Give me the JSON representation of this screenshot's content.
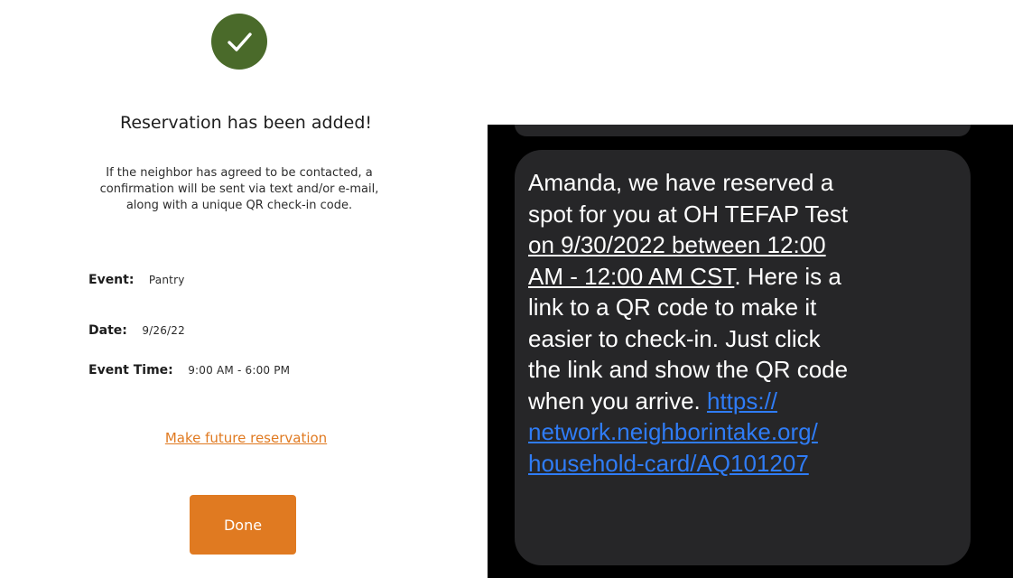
{
  "colors": {
    "success_green": "#4a6a2a",
    "accent_orange": "#e07a21",
    "link_blue": "#2f7cf6",
    "sms_background": "#000000",
    "sms_bubble": "#262628"
  },
  "confirmation": {
    "icon": "check-icon",
    "title": "Reservation has been added!",
    "description": "If the neighbor has agreed to be contacted, a\nconfirmation will be sent via text and/or e-mail,\nalong with a unique QR check-in code.",
    "details": [
      {
        "label": "Event:",
        "value": "Pantry"
      },
      {
        "label": "Date:",
        "value": "9/26/22"
      },
      {
        "label": "Event Time:",
        "value": "9:00 AM - 6:00 PM"
      }
    ],
    "future_link": "Make future reservation",
    "done_label": "Done"
  },
  "sms": {
    "line1": "Amanda, we have reserved a",
    "line2": "spot for you at OH TEFAP Test",
    "line3": "on 9/30/2022 between 12:00",
    "line4a": "AM - 12:00 AM CST",
    "line4b": ". Here is a",
    "line5": "link to a QR code to make it",
    "line6": "easier to check-in. Just click",
    "line7": "the link and show the QR code",
    "line8": "when you arrive. ",
    "link1": "https://",
    "link2": "network.neighborintake.org/",
    "link3": "household-card/AQ101207"
  }
}
